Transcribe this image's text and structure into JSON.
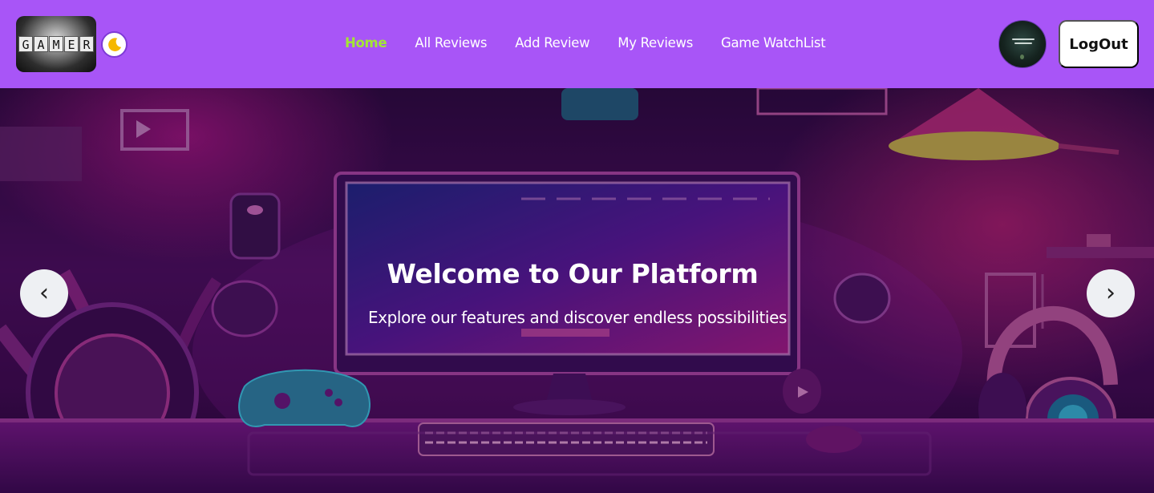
{
  "brand": {
    "logo_text": "GAMER",
    "logo_letters": [
      "G",
      "A",
      "M",
      "E",
      "R"
    ],
    "theme_icon": "moon-icon"
  },
  "nav": {
    "items": [
      {
        "label": "Home",
        "active": true
      },
      {
        "label": "All Reviews",
        "active": false
      },
      {
        "label": "Add Review",
        "active": false
      },
      {
        "label": "My Reviews",
        "active": false
      },
      {
        "label": "Game WatchList",
        "active": false
      }
    ]
  },
  "user": {
    "avatar": "user-avatar",
    "logout_label": "LogOut"
  },
  "hero": {
    "title": "Welcome to Our Platform",
    "subtitle": "Explore our features and discover endless possibilities",
    "prev_symbol": "‹",
    "next_symbol": "›"
  },
  "colors": {
    "navbar_bg": "#a855f7",
    "nav_active": "#a3e635",
    "nav_text": "#ffffff",
    "logout_bg": "#ffffff",
    "hero_bg": "#4a0f5e"
  }
}
